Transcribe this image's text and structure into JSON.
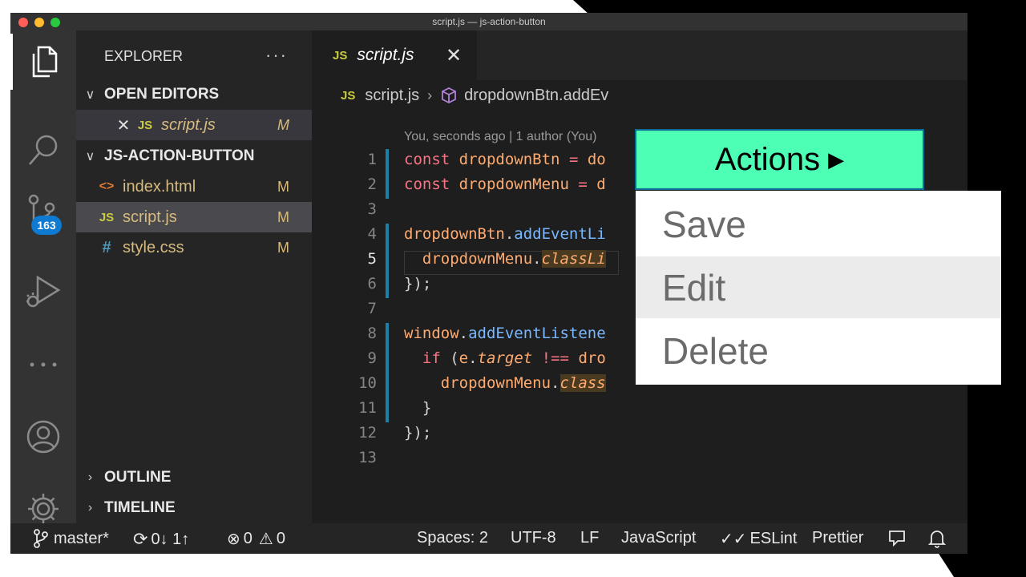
{
  "window": {
    "title": "script.js — js-action-button"
  },
  "activity_bar": {
    "items": [
      {
        "icon": "files-icon"
      },
      {
        "icon": "search-icon"
      },
      {
        "icon": "source-control-icon",
        "badge": "163"
      },
      {
        "icon": "run-debug-icon"
      },
      {
        "icon": "more-icon"
      },
      {
        "icon": "account-icon"
      },
      {
        "icon": "settings-gear-icon"
      }
    ]
  },
  "sidebar": {
    "header": "EXPLORER",
    "more": "···",
    "open_editors": {
      "label": "OPEN EDITORS",
      "items": [
        {
          "icon": "JS",
          "name": "script.js",
          "status": "M"
        }
      ]
    },
    "project": {
      "label": "JS-ACTION-BUTTON",
      "files": [
        {
          "icon": "<>",
          "name": "index.html",
          "status": "M"
        },
        {
          "icon": "JS",
          "name": "script.js",
          "status": "M"
        },
        {
          "icon": "#",
          "name": "style.css",
          "status": "M"
        }
      ]
    },
    "outline_label": "OUTLINE",
    "timeline_label": "TIMELINE"
  },
  "editor": {
    "tab": {
      "icon": "JS",
      "name": "script.js",
      "close": "✕"
    },
    "breadcrumb": {
      "icon": "JS",
      "file": "script.js",
      "symbol": "dropdownBtn.addEv"
    },
    "blame": "You, seconds ago | 1 author (You)",
    "line_numbers": [
      "1",
      "2",
      "3",
      "4",
      "5",
      "6",
      "7",
      "8",
      "9",
      "10",
      "11",
      "12",
      "13"
    ],
    "current_line": 5
  },
  "status_bar": {
    "branch": "master*",
    "sync": "0↓ 1↑",
    "errors": "0",
    "warnings": "0",
    "spaces": "Spaces: 2",
    "encoding": "UTF-8",
    "eol": "LF",
    "language": "JavaScript",
    "eslint": "ESLint",
    "prettier": "Prettier"
  },
  "preview": {
    "button_label": "Actions",
    "button_color": "#4dffb5",
    "menu_items": [
      "Save",
      "Edit",
      "Delete"
    ],
    "hovered_item": "Edit"
  }
}
